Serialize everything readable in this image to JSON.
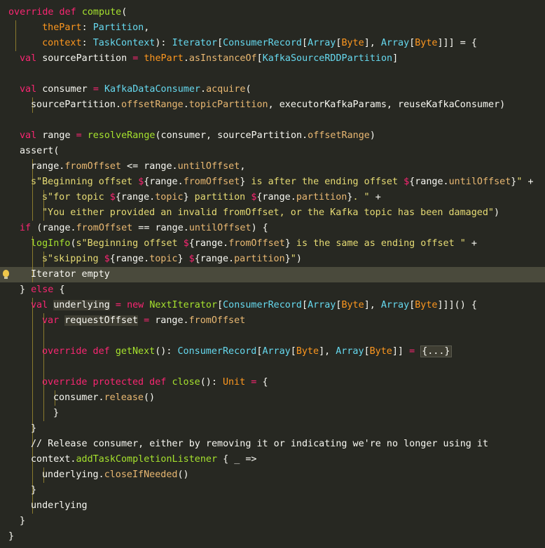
{
  "editor": {
    "gutter_bulb": "lightbulb-icon",
    "lines": [
      [
        [
          "kw",
          "override def "
        ],
        [
          "fn",
          "compute"
        ],
        [
          "ip",
          "("
        ]
      ],
      [
        [
          "ip",
          "  "
        ],
        [
          "pa",
          "thePart"
        ],
        [
          "ip",
          ": "
        ],
        [
          "ty",
          "Partition"
        ],
        [
          "ip",
          ","
        ]
      ],
      [
        [
          "ip",
          "  "
        ],
        [
          "pa",
          "context"
        ],
        [
          "ip",
          ": "
        ],
        [
          "ty",
          "TaskContext"
        ],
        [
          "ip",
          "): "
        ],
        [
          "ty",
          "Iterator"
        ],
        [
          "ip",
          "["
        ],
        [
          "ty",
          "ConsumerRecord"
        ],
        [
          "ip",
          "["
        ],
        [
          "ty",
          "Array"
        ],
        [
          "ip",
          "["
        ],
        [
          "pa",
          "Byte"
        ],
        [
          "ip",
          "], "
        ],
        [
          "ty",
          "Array"
        ],
        [
          "ip",
          "["
        ],
        [
          "pa",
          "Byte"
        ],
        [
          "ip",
          "]]] = {"
        ]
      ],
      [
        [
          "kw",
          "val "
        ],
        [
          "ip",
          "sourcePartition "
        ],
        [
          "op",
          "= "
        ],
        [
          "pa",
          "thePart"
        ],
        [
          "ip",
          "."
        ],
        [
          "fd",
          "asInstanceOf"
        ],
        [
          "ip",
          "["
        ],
        [
          "ty",
          "KafkaSourceRDDPartition"
        ],
        [
          "ip",
          "]"
        ]
      ],
      [],
      [
        [
          "kw",
          "val "
        ],
        [
          "ip",
          "consumer "
        ],
        [
          "op",
          "= "
        ],
        [
          "ty",
          "KafkaDataConsumer"
        ],
        [
          "ip",
          "."
        ],
        [
          "fd",
          "acquire"
        ],
        [
          "ip",
          "("
        ]
      ],
      [
        [
          "ip",
          "sourcePartition."
        ],
        [
          "fd",
          "offsetRange"
        ],
        [
          "ip",
          "."
        ],
        [
          "fd",
          "topicPartition"
        ],
        [
          "ip",
          ", executorKafkaParams, reuseKafkaConsumer)"
        ]
      ],
      [],
      [
        [
          "kw",
          "val "
        ],
        [
          "ip",
          "range "
        ],
        [
          "op",
          "= "
        ],
        [
          "fn",
          "resolveRange"
        ],
        [
          "ip",
          "(consumer, sourcePartition."
        ],
        [
          "fd",
          "offsetRange"
        ],
        [
          "ip",
          ")"
        ]
      ],
      [
        [
          "ip",
          "assert("
        ]
      ],
      [
        [
          "ip",
          "range."
        ],
        [
          "fd",
          "fromOffset"
        ],
        [
          "ip",
          " <= range."
        ],
        [
          "fd",
          "untilOffset"
        ],
        [
          "ip",
          ","
        ]
      ],
      [
        [
          "st",
          "s\"Beginning offset "
        ],
        [
          "kw",
          "$"
        ],
        [
          "ip",
          "{range."
        ],
        [
          "fd",
          "fromOffset"
        ],
        [
          "ip",
          "}"
        ],
        [
          "st",
          " is after the ending offset "
        ],
        [
          "kw",
          "$"
        ],
        [
          "ip",
          "{range."
        ],
        [
          "fd",
          "untilOffset"
        ],
        [
          "ip",
          "}"
        ],
        [
          "st",
          "\" "
        ],
        [
          "ip",
          "+"
        ]
      ],
      [
        [
          "st",
          "s\"for topic "
        ],
        [
          "kw",
          "$"
        ],
        [
          "ip",
          "{range."
        ],
        [
          "fd",
          "topic"
        ],
        [
          "ip",
          "}"
        ],
        [
          "st",
          " partition "
        ],
        [
          "kw",
          "$"
        ],
        [
          "ip",
          "{range."
        ],
        [
          "fd",
          "partition"
        ],
        [
          "ip",
          "}"
        ],
        [
          "st",
          ". \" "
        ],
        [
          "ip",
          "+"
        ]
      ],
      [
        [
          "st",
          "\"You either provided an invalid fromOffset, or the Kafka topic has been damaged\""
        ],
        [
          "ip",
          ")"
        ]
      ],
      [
        [
          "kw",
          "if "
        ],
        [
          "ip",
          "(range."
        ],
        [
          "fd",
          "fromOffset"
        ],
        [
          "ip",
          " == range."
        ],
        [
          "fd",
          "untilOffset"
        ],
        [
          "ip",
          ") {"
        ]
      ],
      [
        [
          "fn",
          "logInfo"
        ],
        [
          "ip",
          "("
        ],
        [
          "st",
          "s\"Beginning offset "
        ],
        [
          "kw",
          "$"
        ],
        [
          "ip",
          "{range."
        ],
        [
          "fd",
          "fromOffset"
        ],
        [
          "ip",
          "}"
        ],
        [
          "st",
          " is the same as ending offset \" "
        ],
        [
          "ip",
          "+"
        ]
      ],
      [
        [
          "st",
          "s\"skipping "
        ],
        [
          "kw",
          "$"
        ],
        [
          "ip",
          "{range."
        ],
        [
          "fd",
          "topic"
        ],
        [
          "ip",
          "} "
        ],
        [
          "kw",
          "$"
        ],
        [
          "ip",
          "{range."
        ],
        [
          "fd",
          "partition"
        ],
        [
          "ip",
          "}"
        ],
        [
          "st",
          "\""
        ],
        [
          "ip",
          ")"
        ]
      ],
      [
        [
          "co",
          "Iterator empty"
        ]
      ],
      [
        [
          "ip",
          "} "
        ],
        [
          "kw",
          "else "
        ],
        [
          "ip",
          "{"
        ]
      ],
      [
        [
          "kw",
          "val "
        ],
        [
          "wr",
          "underlying"
        ],
        [
          "op",
          " = "
        ],
        [
          "kw",
          "new "
        ],
        [
          "fn",
          "NextIterator"
        ],
        [
          "ip",
          "["
        ],
        [
          "ty",
          "ConsumerRecord"
        ],
        [
          "ip",
          "["
        ],
        [
          "ty",
          "Array"
        ],
        [
          "ip",
          "["
        ],
        [
          "pa",
          "Byte"
        ],
        [
          "ip",
          "], "
        ],
        [
          "ty",
          "Array"
        ],
        [
          "ip",
          "["
        ],
        [
          "pa",
          "Byte"
        ],
        [
          "ip",
          "]]]() {"
        ]
      ],
      [
        [
          "kw",
          "var "
        ],
        [
          "wr",
          "requestOffset"
        ],
        [
          "op",
          " = "
        ],
        [
          "ip",
          "range."
        ],
        [
          "fd",
          "fromOffset"
        ]
      ],
      [],
      [
        [
          "kw",
          "override def "
        ],
        [
          "fn",
          "getNext"
        ],
        [
          "ip",
          "(): "
        ],
        [
          "ty",
          "ConsumerRecord"
        ],
        [
          "ip",
          "["
        ],
        [
          "ty",
          "Array"
        ],
        [
          "ip",
          "["
        ],
        [
          "pa",
          "Byte"
        ],
        [
          "ip",
          "], "
        ],
        [
          "ty",
          "Array"
        ],
        [
          "ip",
          "["
        ],
        [
          "pa",
          "Byte"
        ],
        [
          "ip",
          "]] "
        ],
        [
          "op",
          "= "
        ],
        [
          "fold",
          "{...}"
        ]
      ],
      [],
      [
        [
          "kw",
          "override protected def "
        ],
        [
          "fn",
          "close"
        ],
        [
          "ip",
          "(): "
        ],
        [
          "pa",
          "Unit"
        ],
        [
          "op",
          " = "
        ],
        [
          "ip",
          "{"
        ]
      ],
      [
        [
          "ip",
          "consumer."
        ],
        [
          "fd",
          "release"
        ],
        [
          "ip",
          "()"
        ]
      ],
      [
        [
          "ip",
          "}"
        ]
      ],
      [
        [
          "ip",
          "}"
        ]
      ],
      [
        [
          "co",
          "// Release consumer, either by removing it or indicating we're no longer using it"
        ]
      ],
      [
        [
          "ip",
          "context."
        ],
        [
          "fn",
          "addTaskCompletionListener"
        ],
        [
          "ip",
          " { _ =>"
        ]
      ],
      [
        [
          "ip",
          "underlying."
        ],
        [
          "fd",
          "closeIfNeeded"
        ],
        [
          "ip",
          "()"
        ]
      ],
      [
        [
          "ip",
          "}"
        ]
      ],
      [
        [
          "ip",
          "underlying"
        ]
      ],
      [
        [
          "ip",
          "}"
        ]
      ],
      [
        [
          "ip",
          "}"
        ]
      ]
    ]
  }
}
